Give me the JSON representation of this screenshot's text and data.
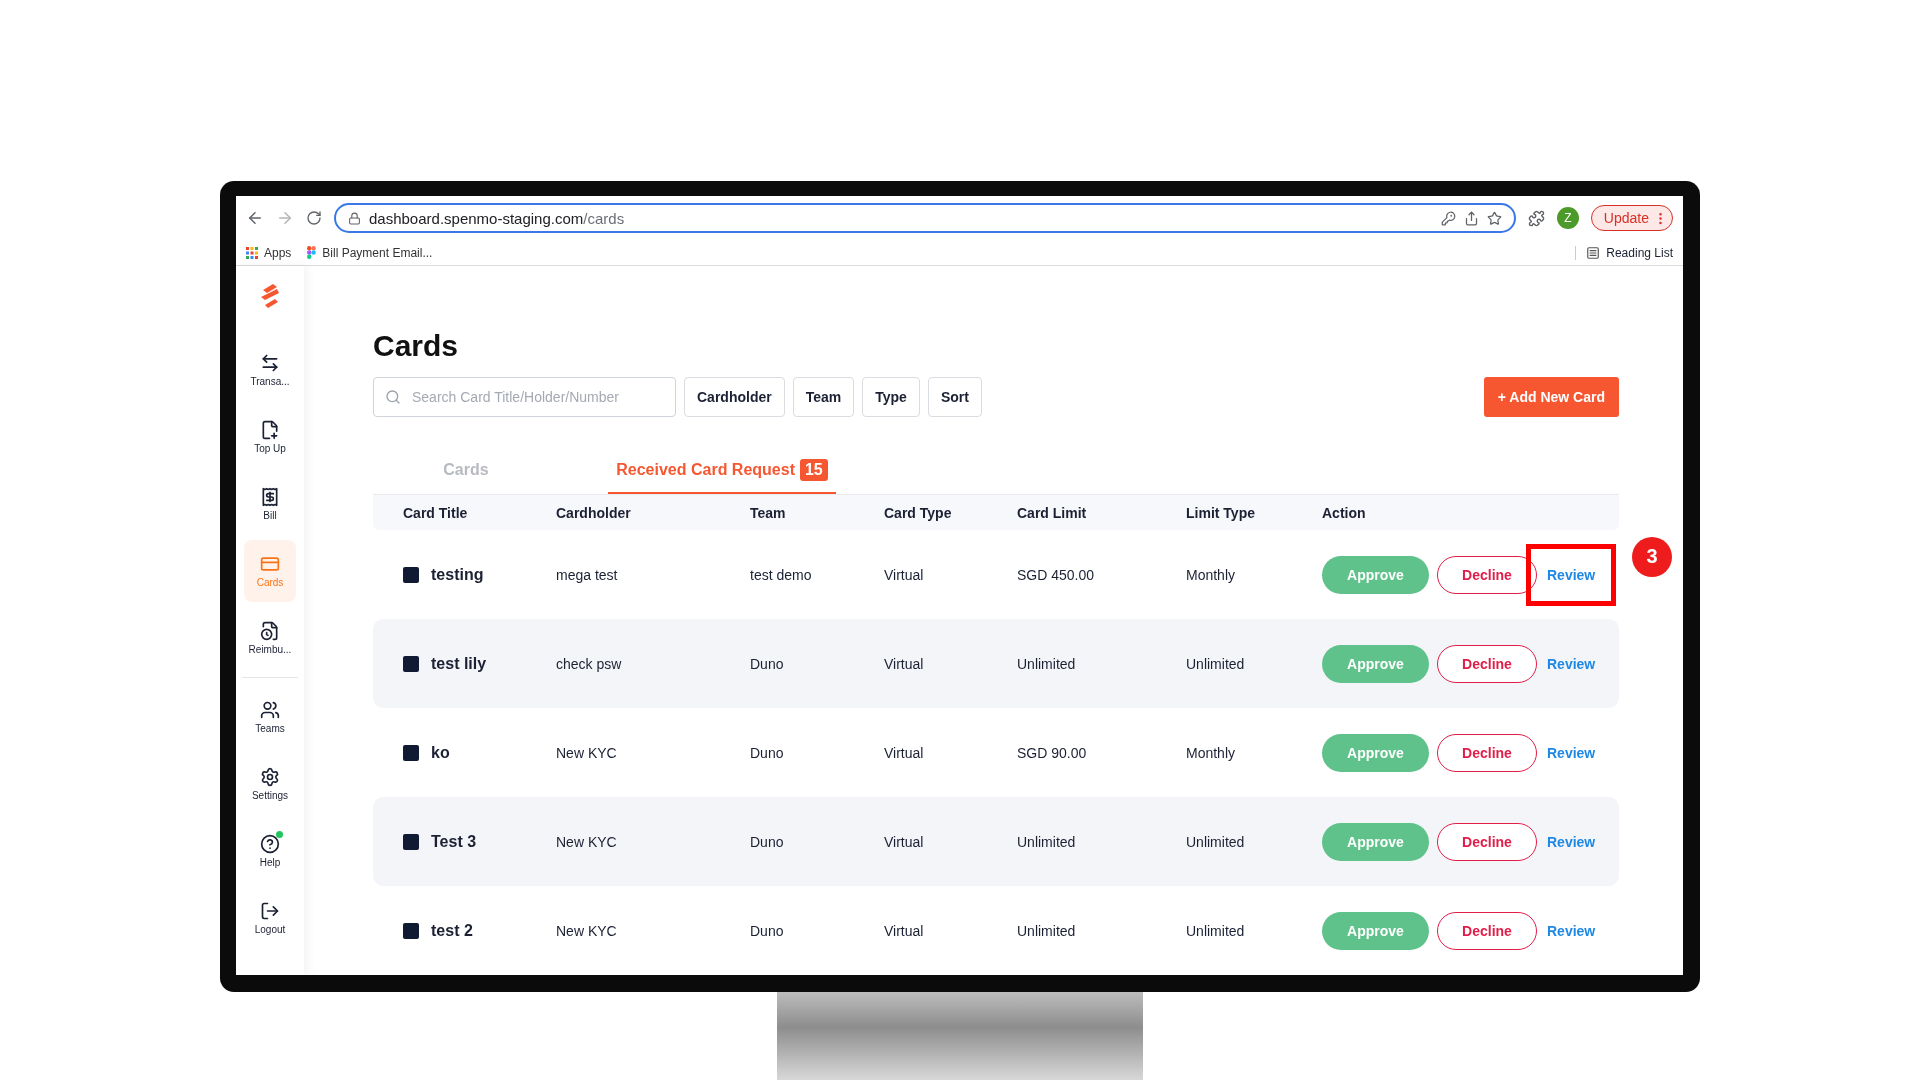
{
  "browser": {
    "url_host": "dashboard.spenmo-staging.com",
    "url_path": "/cards",
    "avatar": "Z",
    "update_label": "Update",
    "bookmarks": [
      "Apps",
      "Bill Payment Email..."
    ],
    "reading_list": "Reading List"
  },
  "sidebar": {
    "groups": [
      [
        {
          "label": "Transa...",
          "selected": false
        },
        {
          "label": "Top Up",
          "selected": false
        },
        {
          "label": "Bill",
          "selected": false
        },
        {
          "label": "Cards",
          "selected": true
        },
        {
          "label": "Reimbu...",
          "selected": false
        }
      ],
      [
        {
          "label": "Teams",
          "selected": false
        },
        {
          "label": "Settings",
          "selected": false
        },
        {
          "label": "Help",
          "selected": false,
          "notification": true
        },
        {
          "label": "Logout",
          "selected": false
        }
      ]
    ]
  },
  "page": {
    "title": "Cards",
    "search": {
      "placeholder": "Search Card Title/Holder/Number"
    },
    "filters": [
      "Cardholder",
      "Team",
      "Type",
      "Sort"
    ],
    "add_button": "+ Add New Card"
  },
  "tabs": [
    {
      "label": "Cards",
      "selected": false
    },
    {
      "label": "Received Card Request",
      "badge": "15",
      "selected": true
    }
  ],
  "table": {
    "columns": [
      "Card Title",
      "Cardholder",
      "Team",
      "Card Type",
      "Card Limit",
      "Limit Type",
      "Action"
    ],
    "rows": [
      {
        "title": "testing",
        "cardholder": "mega test",
        "team": "test demo",
        "type": "Virtual",
        "limit": "SGD 450.00",
        "limit_type": "Monthly",
        "actions": [
          "Approve",
          "Decline",
          "Review"
        ],
        "callout": "3"
      },
      {
        "title": "test lily",
        "cardholder": "check psw",
        "team": "Duno",
        "type": "Virtual",
        "limit": "Unlimited",
        "limit_type": "Unlimited",
        "actions": [
          "Approve",
          "Decline",
          "Review"
        ]
      },
      {
        "title": "ko",
        "cardholder": "New KYC",
        "team": "Duno",
        "type": "Virtual",
        "limit": "SGD 90.00",
        "limit_type": "Monthly",
        "actions": [
          "Approve",
          "Decline",
          "Review"
        ]
      },
      {
        "title": "Test 3",
        "cardholder": "New KYC",
        "team": "Duno",
        "type": "Virtual",
        "limit": "Unlimited",
        "limit_type": "Unlimited",
        "actions": [
          "Approve",
          "Decline",
          "Review"
        ]
      },
      {
        "title": "test 2",
        "cardholder": "New KYC",
        "team": "Duno",
        "type": "Virtual",
        "limit": "Unlimited",
        "limit_type": "Unlimited",
        "actions": [
          "Approve",
          "Decline",
          "Review"
        ]
      }
    ]
  }
}
